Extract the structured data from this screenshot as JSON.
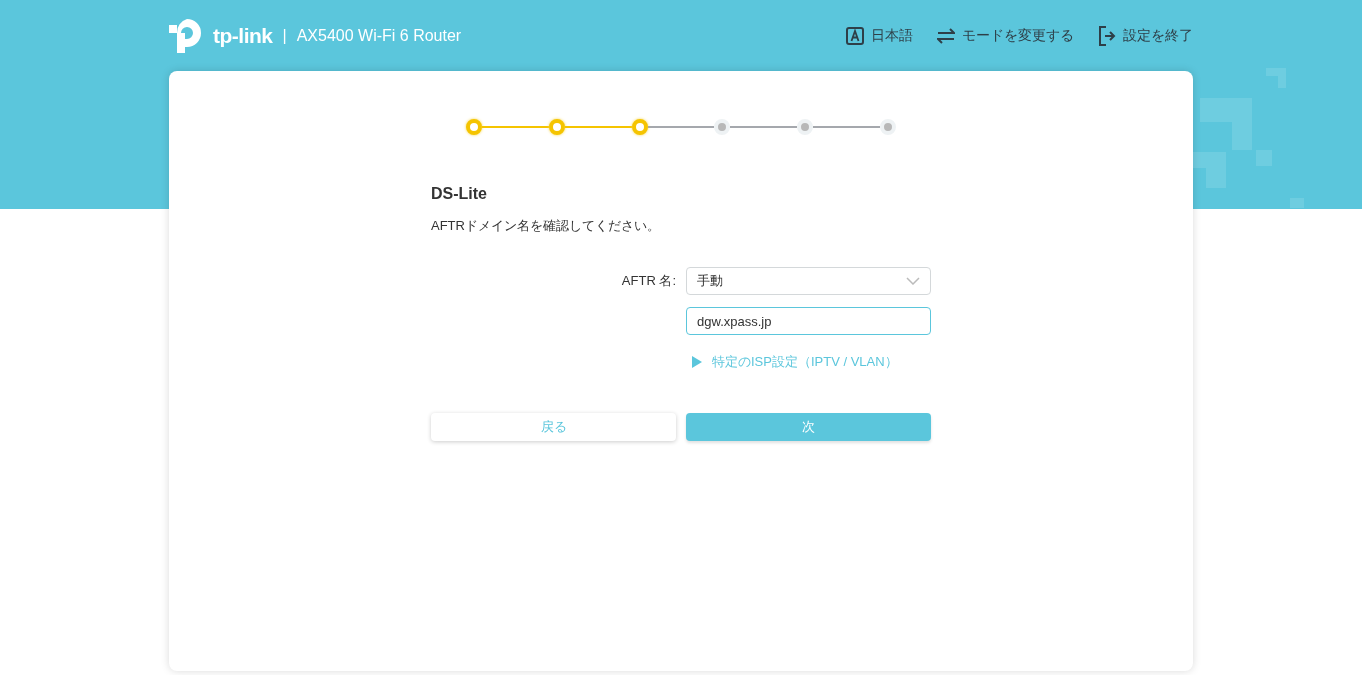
{
  "header": {
    "logo": "tp-link",
    "separator": "|",
    "model": "AX5400 Wi-Fi 6 Router",
    "actions": [
      {
        "kind": "language",
        "label": "日本語"
      },
      {
        "kind": "mode",
        "label": "モードを変更する"
      },
      {
        "kind": "exit",
        "label": "設定を終了"
      }
    ]
  },
  "steps": [
    {
      "completed": true
    },
    {
      "completed": true
    },
    {
      "completed": true
    },
    {
      "completed": false
    },
    {
      "completed": false
    },
    {
      "completed": false
    }
  ],
  "title": "DS-Lite",
  "description": "AFTRドメイン名を確認してください。",
  "form": {
    "label": "AFTR 名:",
    "select_value": "手動",
    "input_value": "dgw.xpass.jp",
    "advanced_link": "特定のISP設定（IPTV / VLAN）",
    "expanded": false
  },
  "buttons": {
    "back": "戻る",
    "next": "次"
  }
}
